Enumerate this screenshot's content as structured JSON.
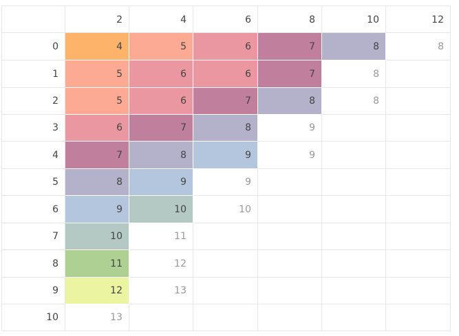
{
  "chart_data": {
    "type": "table",
    "columns": [
      "2",
      "4",
      "6",
      "8",
      "10",
      "12"
    ],
    "rows": [
      {
        "label": "0",
        "cells": [
          {
            "v": "4",
            "c": "#fdb46a"
          },
          {
            "v": "5",
            "c": "#fdaa94"
          },
          {
            "v": "6",
            "c": "#eb97a1"
          },
          {
            "v": "7",
            "c": "#bf7f9d"
          },
          {
            "v": "8",
            "c": "#b4b1cb"
          },
          {
            "v": "8",
            "c": null
          }
        ]
      },
      {
        "label": "1",
        "cells": [
          {
            "v": "5",
            "c": "#fdaa94"
          },
          {
            "v": "6",
            "c": "#eb97a1"
          },
          {
            "v": "6",
            "c": "#eb97a1"
          },
          {
            "v": "7",
            "c": "#bf7f9d"
          },
          {
            "v": "8",
            "c": null
          },
          {
            "v": "",
            "c": null
          }
        ]
      },
      {
        "label": "2",
        "cells": [
          {
            "v": "5",
            "c": "#fdaa94"
          },
          {
            "v": "6",
            "c": "#eb97a1"
          },
          {
            "v": "7",
            "c": "#bf7f9d"
          },
          {
            "v": "8",
            "c": "#b4b1cb"
          },
          {
            "v": "8",
            "c": null
          },
          {
            "v": "",
            "c": null
          }
        ]
      },
      {
        "label": "3",
        "cells": [
          {
            "v": "6",
            "c": "#eb97a1"
          },
          {
            "v": "7",
            "c": "#bf7f9d"
          },
          {
            "v": "8",
            "c": "#b4b1cb"
          },
          {
            "v": "9",
            "c": null
          },
          {
            "v": "",
            "c": null
          },
          {
            "v": "",
            "c": null
          }
        ]
      },
      {
        "label": "4",
        "cells": [
          {
            "v": "7",
            "c": "#bf7f9d"
          },
          {
            "v": "8",
            "c": "#b4b1cb"
          },
          {
            "v": "9",
            "c": "#b4c6dd"
          },
          {
            "v": "9",
            "c": null
          },
          {
            "v": "",
            "c": null
          },
          {
            "v": "",
            "c": null
          }
        ]
      },
      {
        "label": "5",
        "cells": [
          {
            "v": "8",
            "c": "#b4b1cb"
          },
          {
            "v": "9",
            "c": "#b4c6dd"
          },
          {
            "v": "9",
            "c": null
          },
          {
            "v": "",
            "c": null
          },
          {
            "v": "",
            "c": null
          },
          {
            "v": "",
            "c": null
          }
        ]
      },
      {
        "label": "6",
        "cells": [
          {
            "v": "9",
            "c": "#b4c6dd"
          },
          {
            "v": "10",
            "c": "#b4c8c4"
          },
          {
            "v": "10",
            "c": null
          },
          {
            "v": "",
            "c": null
          },
          {
            "v": "",
            "c": null
          },
          {
            "v": "",
            "c": null
          }
        ]
      },
      {
        "label": "7",
        "cells": [
          {
            "v": "10",
            "c": "#b4c8c4"
          },
          {
            "v": "11",
            "c": null
          },
          {
            "v": "",
            "c": null
          },
          {
            "v": "",
            "c": null
          },
          {
            "v": "",
            "c": null
          },
          {
            "v": "",
            "c": null
          }
        ]
      },
      {
        "label": "8",
        "cells": [
          {
            "v": "11",
            "c": "#afd093"
          },
          {
            "v": "12",
            "c": null
          },
          {
            "v": "",
            "c": null
          },
          {
            "v": "",
            "c": null
          },
          {
            "v": "",
            "c": null
          },
          {
            "v": "",
            "c": null
          }
        ]
      },
      {
        "label": "9",
        "cells": [
          {
            "v": "12",
            "c": "#eaf4a1"
          },
          {
            "v": "13",
            "c": null
          },
          {
            "v": "",
            "c": null
          },
          {
            "v": "",
            "c": null
          },
          {
            "v": "",
            "c": null
          },
          {
            "v": "",
            "c": null
          }
        ]
      },
      {
        "label": "10",
        "cells": [
          {
            "v": "13",
            "c": null
          },
          {
            "v": "",
            "c": null
          },
          {
            "v": "",
            "c": null
          },
          {
            "v": "",
            "c": null
          },
          {
            "v": "",
            "c": null
          },
          {
            "v": "",
            "c": null
          }
        ]
      }
    ],
    "colors": {
      "gridline": "#e6e6e6",
      "header_text": "#444444",
      "cell_text": "#444444",
      "muted_text": "#999999"
    }
  }
}
